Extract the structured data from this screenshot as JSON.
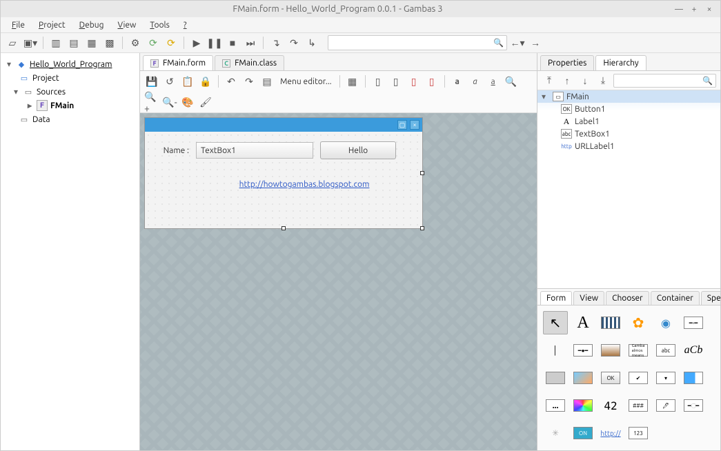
{
  "window": {
    "title": "FMain.form - Hello_World_Program 0.0.1 - Gambas 3"
  },
  "menus": [
    "File",
    "Project",
    "Debug",
    "View",
    "Tools",
    "?"
  ],
  "tree": {
    "root": "Hello_World_Program",
    "project": "Project",
    "sources": "Sources",
    "fmain": "FMain",
    "data": "Data"
  },
  "tabs": [
    {
      "label": "FMain.form",
      "icon": "F",
      "active": true
    },
    {
      "label": "FMain.class",
      "icon": "C",
      "active": false
    }
  ],
  "editorToolbar": {
    "menuEditor": "Menu editor..."
  },
  "designForm": {
    "nameLabel": "Name :",
    "textboxText": "TextBox1",
    "buttonText": "Hello",
    "url": "http://howtogambas.blogspot.com"
  },
  "rightTabs": {
    "properties": "Properties",
    "hierarchy": "Hierarchy"
  },
  "hierarchy": {
    "root": "FMain",
    "items": [
      {
        "name": "Button1",
        "ic": "OK"
      },
      {
        "name": "Label1",
        "ic": "A"
      },
      {
        "name": "TextBox1",
        "ic": "abc"
      },
      {
        "name": "URLLabel1",
        "ic": "http"
      }
    ]
  },
  "toolbox": {
    "tabs": [
      "Form",
      "View",
      "Chooser",
      "Container",
      "Spe"
    ],
    "icons": [
      "pointer",
      "A",
      "movie",
      "flower",
      "radio",
      "slider-h",
      "sep-v",
      "slider",
      "color",
      "gambas",
      "abc",
      "aCb",
      "square",
      "paint",
      "OK",
      "check",
      "combo",
      "progress",
      "...",
      "palette",
      "42",
      "###",
      "picker",
      "slider2",
      "spin",
      "on",
      "url",
      "123"
    ]
  }
}
